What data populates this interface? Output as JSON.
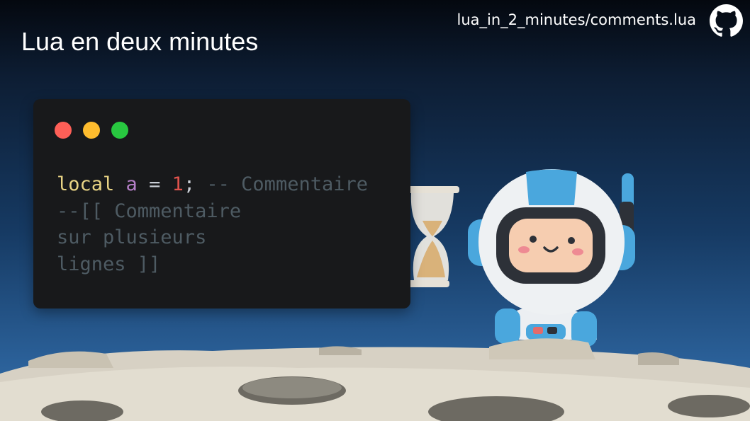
{
  "header": {
    "title": "Lua en deux minutes",
    "file_path": "lua_in_2_minutes/comments.lua"
  },
  "icons": {
    "repo": "github-icon",
    "hourglass": "hourglass-icon",
    "mascot": "astronaut-illustration"
  },
  "code_window": {
    "dots": [
      "#fe5f57",
      "#febc2e",
      "#28c840"
    ],
    "line1": {
      "keyword": "local",
      "variable": "a",
      "operator": "=",
      "number": "1",
      "semicolon": ";",
      "comment": "-- Commentaire"
    },
    "block_comment": [
      "--[[ Commentaire",
      "sur plusieurs",
      "lignes ]]"
    ]
  },
  "colors": {
    "keyword": "#e8d384",
    "variable": "#b57fc8",
    "number": "#e0534d",
    "comment": "#4e5b63",
    "window_bg": "#18191b"
  }
}
